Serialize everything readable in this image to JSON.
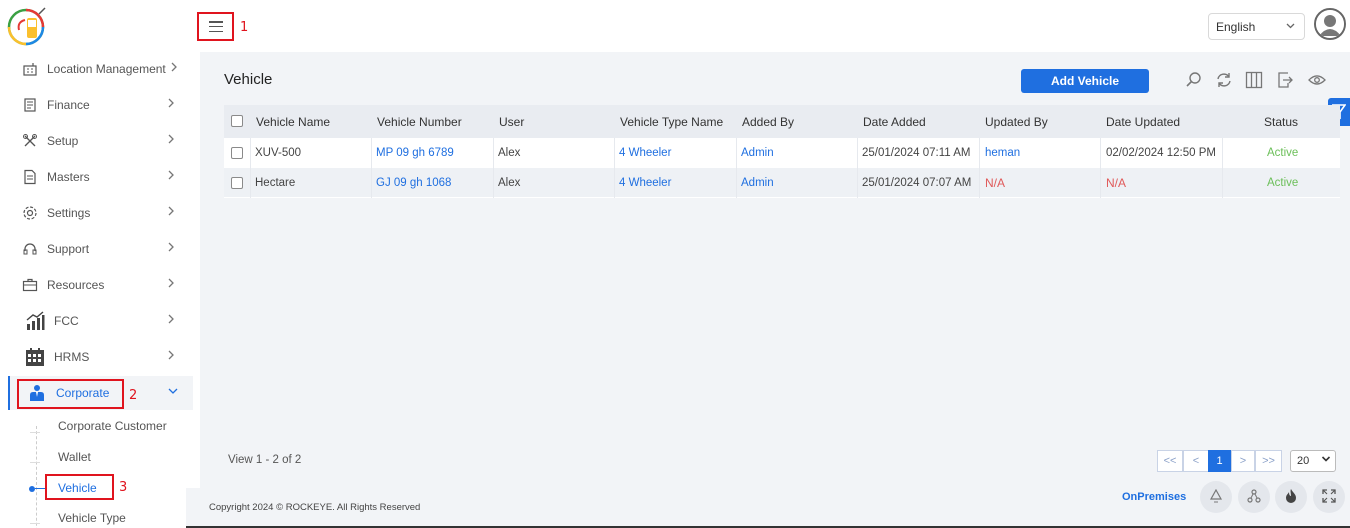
{
  "header": {
    "language": "English",
    "annotations": [
      "1",
      "2",
      "3"
    ]
  },
  "sidebar": {
    "items": [
      {
        "label": "Location Management",
        "icon": "location-icon"
      },
      {
        "label": "Finance",
        "icon": "finance-icon"
      },
      {
        "label": "Setup",
        "icon": "tools-icon"
      },
      {
        "label": "Masters",
        "icon": "document-icon"
      },
      {
        "label": "Settings",
        "icon": "gear-icon"
      },
      {
        "label": "Support",
        "icon": "headset-icon"
      },
      {
        "label": "Resources",
        "icon": "briefcase-icon"
      },
      {
        "label": "FCC",
        "icon": "chart-icon"
      },
      {
        "label": "HRMS",
        "icon": "calendar-icon"
      },
      {
        "label": "Corporate",
        "icon": "corporate-icon"
      }
    ],
    "subitems": [
      "Corporate Customer",
      "Wallet",
      "Vehicle",
      "Vehicle Type"
    ]
  },
  "main": {
    "title": "Vehicle",
    "add_button": "Add Vehicle",
    "columns": [
      "Vehicle Name",
      "Vehicle Number",
      "User",
      "Vehicle Type Name",
      "Added By",
      "Date Added",
      "Updated By",
      "Date Updated",
      "Status"
    ],
    "rows": [
      [
        "XUV-500",
        "MP 09 gh 6789",
        "Alex",
        "4 Wheeler",
        "Admin",
        "25/01/2024 07:11 AM",
        "heman",
        "02/02/2024 12:50 PM",
        "Active"
      ],
      [
        "Hectare",
        "GJ 09 gh 1068",
        "Alex",
        "4 Wheeler",
        "Admin",
        "25/01/2024 07:07 AM",
        "N/A",
        "N/A",
        "Active"
      ]
    ],
    "view_info": "View 1 - 2 of 2",
    "pager": {
      "first": "<<",
      "prev": "<",
      "current": "1",
      "next": ">",
      "last": ">>",
      "page_size": "20"
    }
  },
  "footer": {
    "copyright": "Copyright 2024 © ROCKEYE. All Rights Reserved",
    "mode": "OnPremises"
  },
  "colors": {
    "accent": "#1f6fe0",
    "annotation": "#e0141e",
    "active_status": "#6bbf59",
    "na": "#e05a5a"
  }
}
